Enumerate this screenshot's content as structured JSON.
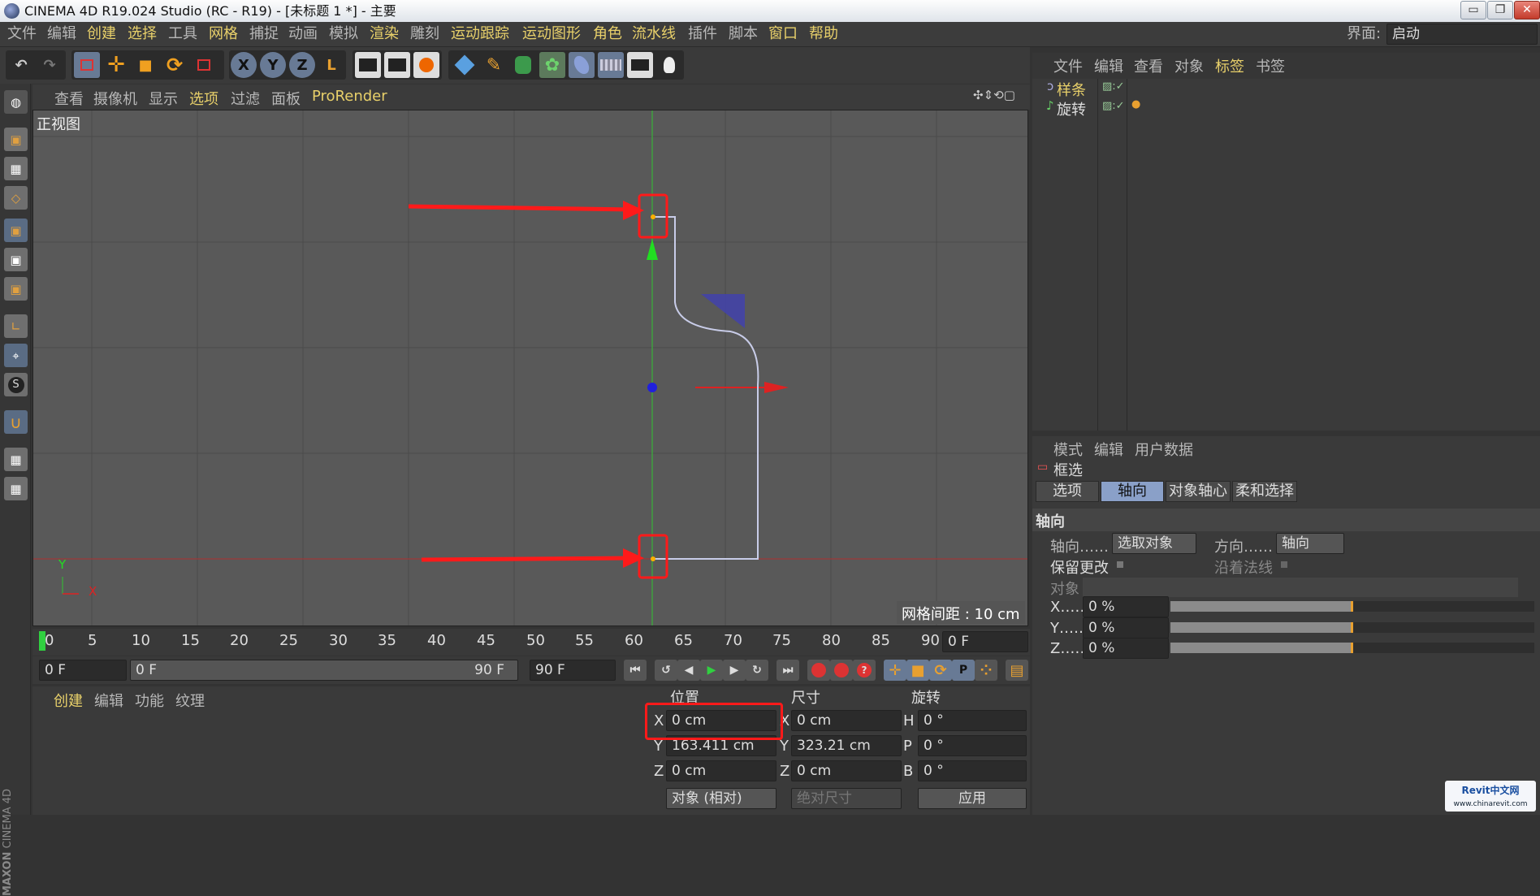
{
  "window": {
    "title": "CINEMA 4D R19.024 Studio (RC - R19) - [未标题 1 *] - 主要",
    "btn_min": "▭",
    "btn_max": "❐",
    "btn_close": "✕"
  },
  "menubar": {
    "items": [
      "文件",
      "编辑",
      "创建",
      "选择",
      "工具",
      "网格",
      "捕捉",
      "动画",
      "模拟",
      "渲染",
      "雕刻",
      "运动跟踪",
      "运动图形",
      "角色",
      "流水线",
      "插件",
      "脚本",
      "窗口",
      "帮助"
    ],
    "layout_label": "界面:",
    "layout_value": "启动"
  },
  "toolbar": {
    "undo": "↶",
    "redo": "↷",
    "move": "✛",
    "scale": "■",
    "rotate": "⟳",
    "x": "X",
    "y": "Y",
    "z": "Z",
    "coord": "L"
  },
  "viewport": {
    "menu": [
      "查看",
      "摄像机",
      "显示",
      "选项",
      "过滤",
      "面板",
      "ProRender"
    ],
    "view_name": "正视图",
    "grid_spacing": "网格间距 : 10 cm",
    "axis_x": "X",
    "axis_y": "Y"
  },
  "timeline": {
    "ticks": [
      "0",
      "5",
      "10",
      "15",
      "20",
      "25",
      "30",
      "35",
      "40",
      "45",
      "50",
      "55",
      "60",
      "65",
      "70",
      "75",
      "80",
      "85",
      "90"
    ],
    "current": "0 F"
  },
  "playbar": {
    "start": "0 F",
    "range_start": "0 F",
    "range_end": "90 F",
    "end": "90 F"
  },
  "material": {
    "tabs": [
      "创建",
      "编辑",
      "功能",
      "纹理"
    ]
  },
  "coords": {
    "headers": [
      "位置",
      "尺寸",
      "旋转"
    ],
    "rows": [
      {
        "a": "X",
        "pos": "0 cm",
        "b": "X",
        "size": "0 cm",
        "c": "H",
        "rot": "0 °"
      },
      {
        "a": "Y",
        "pos": "163.411 cm",
        "b": "Y",
        "size": "323.21 cm",
        "c": "P",
        "rot": "0 °"
      },
      {
        "a": "Z",
        "pos": "0 cm",
        "b": "Z",
        "size": "0 cm",
        "c": "B",
        "rot": "0 °"
      }
    ],
    "mode": "对象 (相对)",
    "size_mode": "绝对尺寸",
    "apply": "应用"
  },
  "objects": {
    "menu": [
      "文件",
      "编辑",
      "查看",
      "对象",
      "标签",
      "书签"
    ],
    "items": [
      "样条",
      "旋转"
    ]
  },
  "attributes": {
    "menu": [
      "模式",
      "编辑",
      "用户数据"
    ],
    "tool": "框选",
    "tabs": [
      "选项",
      "轴向",
      "对象轴心",
      "柔和选择"
    ],
    "section": "轴向",
    "axis_label": "轴向……",
    "axis_value": "选取对象",
    "dir_label": "方向……",
    "dir_value": "轴向",
    "keep_label": "保留更改",
    "normal_label": "沿着法线",
    "object_label": "对象",
    "x_label": "X……",
    "x_value": "0 %",
    "y_label": "Y……",
    "y_value": "0 %",
    "z_label": "Z……",
    "z_value": "0 %"
  },
  "watermark": {
    "brand": "Revit中文网",
    "url": "www.chinarevit.com",
    "maxon": "MAXON",
    "c4d": "CINEMA 4D"
  }
}
